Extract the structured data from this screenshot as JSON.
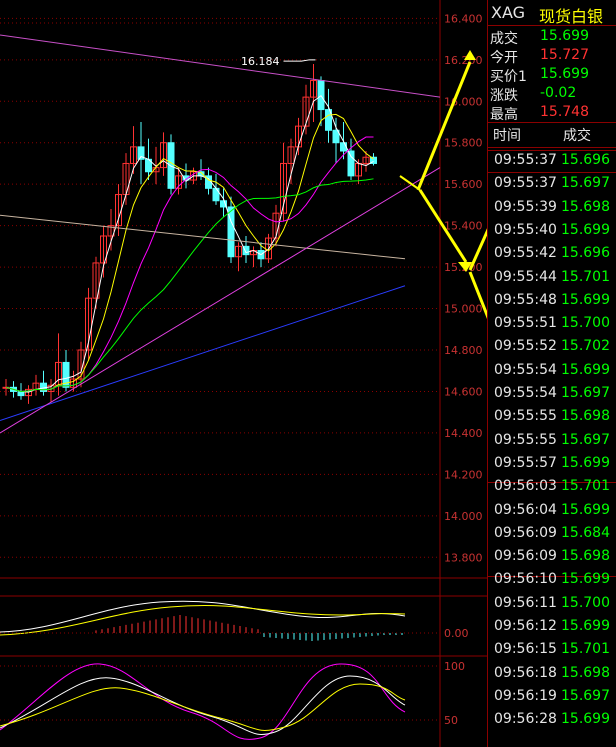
{
  "colors": {
    "up": "#ff3232",
    "down": "#54ffff",
    "price_neutral": "#ff3232",
    "gain": "#00ff00",
    "axis_text": "#c83232",
    "arrow": "#ffff00",
    "grid": "#8b0000"
  },
  "quote": {
    "symbol": "XAG",
    "name": "现货白银",
    "rows": [
      {
        "label": "成交",
        "value": "15.699",
        "color": "#00ff00"
      },
      {
        "label": "今开",
        "value": "15.727",
        "color": "#ff3232"
      },
      {
        "label": "买价1",
        "value": "15.699",
        "color": "#00ff00"
      },
      {
        "label": "涨跌",
        "value": "-0.02",
        "color": "#00ff00"
      },
      {
        "label": "最高",
        "value": "15.748",
        "color": "#ff3232"
      }
    ]
  },
  "trades": {
    "header_time": "时间",
    "header_price": "成交",
    "rows": [
      {
        "time": "09:55:37",
        "price": "15.696"
      },
      {
        "time": "09:55:37",
        "price": "15.697"
      },
      {
        "time": "09:55:39",
        "price": "15.698"
      },
      {
        "time": "09:55:40",
        "price": "15.699"
      },
      {
        "time": "09:55:42",
        "price": "15.696"
      },
      {
        "time": "09:55:44",
        "price": "15.701"
      },
      {
        "time": "09:55:48",
        "price": "15.699"
      },
      {
        "time": "09:55:51",
        "price": "15.700"
      },
      {
        "time": "09:55:52",
        "price": "15.702"
      },
      {
        "time": "09:55:54",
        "price": "15.699"
      },
      {
        "time": "09:55:54",
        "price": "15.697"
      },
      {
        "time": "09:55:55",
        "price": "15.698"
      },
      {
        "time": "09:55:55",
        "price": "15.697"
      },
      {
        "time": "09:55:57",
        "price": "15.699"
      },
      {
        "time": "09:56:03",
        "price": "15.701"
      },
      {
        "time": "09:56:04",
        "price": "15.699"
      },
      {
        "time": "09:56:09",
        "price": "15.684"
      },
      {
        "time": "09:56:09",
        "price": "15.698"
      },
      {
        "time": "09:56:10",
        "price": "15.699"
      },
      {
        "time": "09:56:11",
        "price": "15.700"
      },
      {
        "time": "09:56:12",
        "price": "15.699"
      },
      {
        "time": "09:56:15",
        "price": "15.701"
      },
      {
        "time": "09:56:18",
        "price": "15.698"
      },
      {
        "time": "09:56:19",
        "price": "15.697"
      },
      {
        "time": "09:56:28",
        "price": "15.699"
      }
    ]
  },
  "chart_data": [
    {
      "type": "candlestick",
      "price_axis_ticks": [
        "16.400",
        "16.200",
        "16.000",
        "15.800",
        "15.600",
        "15.400",
        "15.200",
        "15.000",
        "14.800",
        "14.600",
        "14.400",
        "14.200",
        "14.000",
        "13.800"
      ],
      "ylim": [
        13.7,
        16.45
      ],
      "max_label": "16.184",
      "candles": [
        [
          14.62,
          14.66,
          14.58,
          14.62
        ],
        [
          14.62,
          14.65,
          14.57,
          14.6
        ],
        [
          14.6,
          14.64,
          14.56,
          14.58
        ],
        [
          14.58,
          14.63,
          14.54,
          14.61
        ],
        [
          14.61,
          14.68,
          14.58,
          14.64
        ],
        [
          14.64,
          14.7,
          14.58,
          14.6
        ],
        [
          14.6,
          14.66,
          14.55,
          14.63
        ],
        [
          14.63,
          14.88,
          14.58,
          14.74
        ],
        [
          14.74,
          14.8,
          14.6,
          14.62
        ],
        [
          14.62,
          14.7,
          14.6,
          14.66
        ],
        [
          14.66,
          14.84,
          14.62,
          14.8
        ],
        [
          14.8,
          15.1,
          14.75,
          15.05
        ],
        [
          15.05,
          15.25,
          15.0,
          15.22
        ],
        [
          15.22,
          15.4,
          15.15,
          15.35
        ],
        [
          15.35,
          15.48,
          15.28,
          15.4
        ],
        [
          15.4,
          15.6,
          15.35,
          15.55
        ],
        [
          15.55,
          15.75,
          15.5,
          15.7
        ],
        [
          15.7,
          15.88,
          15.65,
          15.78
        ],
        [
          15.78,
          15.9,
          15.6,
          15.72
        ],
        [
          15.72,
          15.82,
          15.62,
          15.66
        ],
        [
          15.66,
          15.78,
          15.6,
          15.68
        ],
        [
          15.68,
          15.85,
          15.64,
          15.8
        ],
        [
          15.8,
          15.84,
          15.55,
          15.58
        ],
        [
          15.58,
          15.68,
          15.55,
          15.64
        ],
        [
          15.64,
          15.7,
          15.58,
          15.62
        ],
        [
          15.62,
          15.68,
          15.6,
          15.66
        ],
        [
          15.66,
          15.72,
          15.62,
          15.64
        ],
        [
          15.64,
          15.68,
          15.55,
          15.58
        ],
        [
          15.58,
          15.65,
          15.5,
          15.52
        ],
        [
          15.52,
          15.58,
          15.44,
          15.49
        ],
        [
          15.49,
          15.54,
          15.22,
          15.25
        ],
        [
          15.25,
          15.32,
          15.18,
          15.3
        ],
        [
          15.3,
          15.35,
          15.22,
          15.26
        ],
        [
          15.26,
          15.3,
          15.2,
          15.28
        ],
        [
          15.28,
          15.32,
          15.2,
          15.24
        ],
        [
          15.24,
          15.36,
          15.22,
          15.34
        ],
        [
          15.34,
          15.5,
          15.3,
          15.46
        ],
        [
          15.46,
          15.8,
          15.42,
          15.7
        ],
        [
          15.7,
          15.82,
          15.6,
          15.78
        ],
        [
          15.78,
          15.92,
          15.74,
          15.88
        ],
        [
          15.88,
          16.08,
          15.84,
          16.02
        ],
        [
          16.02,
          16.18,
          15.9,
          16.1
        ],
        [
          16.1,
          16.12,
          15.88,
          15.96
        ],
        [
          15.96,
          16.06,
          15.8,
          15.86
        ],
        [
          15.86,
          15.92,
          15.7,
          15.8
        ],
        [
          15.8,
          15.9,
          15.72,
          15.76
        ],
        [
          15.76,
          15.82,
          15.62,
          15.64
        ],
        [
          15.64,
          15.72,
          15.6,
          15.7
        ],
        [
          15.7,
          15.76,
          15.66,
          15.73
        ],
        [
          15.73,
          15.75,
          15.69,
          15.7
        ]
      ]
    },
    {
      "type": "macd",
      "zero_label": "0.00"
    },
    {
      "type": "kdj",
      "axis_ticks": [
        "100",
        "50"
      ]
    }
  ]
}
